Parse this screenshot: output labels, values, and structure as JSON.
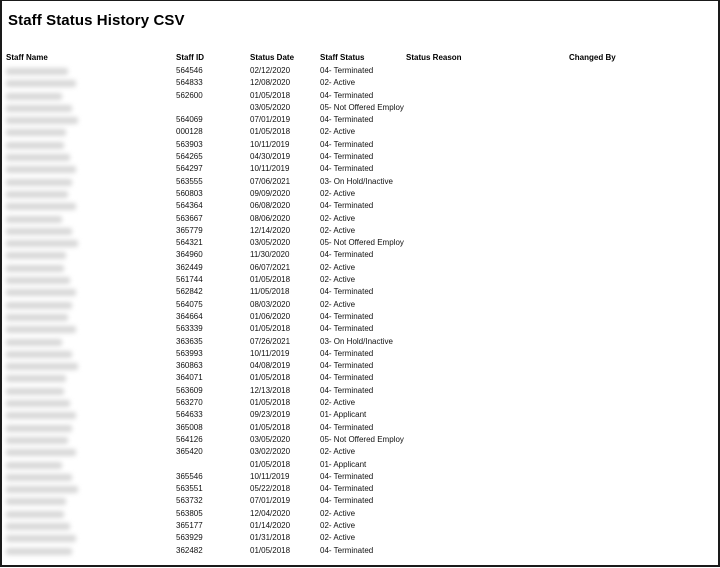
{
  "title": "Staff Status History CSV",
  "columns": [
    "Staff Name",
    "Staff ID",
    "Status Date",
    "Staff Status",
    "Status Reason",
    "Changed By"
  ],
  "rows": [
    {
      "name": "",
      "id": "564546",
      "date": "02/12/2020",
      "status": "04- Terminated",
      "reason": "",
      "changed_by": ""
    },
    {
      "name": "",
      "id": "564833",
      "date": "12/08/2020",
      "status": "02- Active",
      "reason": "",
      "changed_by": ""
    },
    {
      "name": "",
      "id": "562600",
      "date": "01/05/2018",
      "status": "04- Terminated",
      "reason": "",
      "changed_by": ""
    },
    {
      "name": "",
      "id": "",
      "date": "03/05/2020",
      "status": "05- Not Offered Employ",
      "reason": "",
      "changed_by": ""
    },
    {
      "name": "",
      "id": "564069",
      "date": "07/01/2019",
      "status": "04- Terminated",
      "reason": "",
      "changed_by": ""
    },
    {
      "name": "",
      "id": "000128",
      "date": "01/05/2018",
      "status": "02- Active",
      "reason": "",
      "changed_by": ""
    },
    {
      "name": "",
      "id": "563903",
      "date": "10/11/2019",
      "status": "04- Terminated",
      "reason": "",
      "changed_by": ""
    },
    {
      "name": "",
      "id": "564265",
      "date": "04/30/2019",
      "status": "04- Terminated",
      "reason": "",
      "changed_by": ""
    },
    {
      "name": "",
      "id": "564297",
      "date": "10/11/2019",
      "status": "04- Terminated",
      "reason": "",
      "changed_by": ""
    },
    {
      "name": "",
      "id": "563555",
      "date": "07/06/2021",
      "status": "03- On Hold/Inactive",
      "reason": "",
      "changed_by": ""
    },
    {
      "name": "",
      "id": "560803",
      "date": "09/09/2020",
      "status": "02- Active",
      "reason": "",
      "changed_by": ""
    },
    {
      "name": "",
      "id": "564364",
      "date": "06/08/2020",
      "status": "04- Terminated",
      "reason": "",
      "changed_by": ""
    },
    {
      "name": "",
      "id": "563667",
      "date": "08/06/2020",
      "status": "02- Active",
      "reason": "",
      "changed_by": ""
    },
    {
      "name": "",
      "id": "365779",
      "date": "12/14/2020",
      "status": "02- Active",
      "reason": "",
      "changed_by": ""
    },
    {
      "name": "",
      "id": "564321",
      "date": "03/05/2020",
      "status": "05- Not Offered Employ",
      "reason": "",
      "changed_by": ""
    },
    {
      "name": "",
      "id": "364960",
      "date": "11/30/2020",
      "status": "04- Terminated",
      "reason": "",
      "changed_by": ""
    },
    {
      "name": "",
      "id": "362449",
      "date": "06/07/2021",
      "status": "02- Active",
      "reason": "",
      "changed_by": ""
    },
    {
      "name": "",
      "id": "561744",
      "date": "01/05/2018",
      "status": "02- Active",
      "reason": "",
      "changed_by": ""
    },
    {
      "name": "",
      "id": "562842",
      "date": "11/05/2018",
      "status": "04- Terminated",
      "reason": "",
      "changed_by": ""
    },
    {
      "name": "",
      "id": "564075",
      "date": "08/03/2020",
      "status": "02- Active",
      "reason": "",
      "changed_by": ""
    },
    {
      "name": "",
      "id": "364664",
      "date": "01/06/2020",
      "status": "04- Terminated",
      "reason": "",
      "changed_by": ""
    },
    {
      "name": "",
      "id": "563339",
      "date": "01/05/2018",
      "status": "04- Terminated",
      "reason": "",
      "changed_by": ""
    },
    {
      "name": "",
      "id": "363635",
      "date": "07/26/2021",
      "status": "03- On Hold/Inactive",
      "reason": "",
      "changed_by": ""
    },
    {
      "name": "",
      "id": "563993",
      "date": "10/11/2019",
      "status": "04- Terminated",
      "reason": "",
      "changed_by": ""
    },
    {
      "name": "",
      "id": "360863",
      "date": "04/08/2019",
      "status": "04- Terminated",
      "reason": "",
      "changed_by": ""
    },
    {
      "name": "",
      "id": "364071",
      "date": "01/05/2018",
      "status": "04- Terminated",
      "reason": "",
      "changed_by": ""
    },
    {
      "name": "",
      "id": "563609",
      "date": "12/13/2018",
      "status": "04- Terminated",
      "reason": "",
      "changed_by": ""
    },
    {
      "name": "",
      "id": "563270",
      "date": "01/05/2018",
      "status": "02- Active",
      "reason": "",
      "changed_by": ""
    },
    {
      "name": "",
      "id": "564633",
      "date": "09/23/2019",
      "status": "01- Applicant",
      "reason": "",
      "changed_by": ""
    },
    {
      "name": "",
      "id": "365008",
      "date": "01/05/2018",
      "status": "04- Terminated",
      "reason": "",
      "changed_by": ""
    },
    {
      "name": "",
      "id": "564126",
      "date": "03/05/2020",
      "status": "05- Not Offered Employ",
      "reason": "",
      "changed_by": ""
    },
    {
      "name": "",
      "id": "365420",
      "date": "03/02/2020",
      "status": "02- Active",
      "reason": "",
      "changed_by": ""
    },
    {
      "name": "",
      "id": "",
      "date": "01/05/2018",
      "status": "01- Applicant",
      "reason": "",
      "changed_by": ""
    },
    {
      "name": "",
      "id": "365546",
      "date": "10/11/2019",
      "status": "04- Terminated",
      "reason": "",
      "changed_by": ""
    },
    {
      "name": "",
      "id": "563551",
      "date": "05/22/2018",
      "status": "04- Terminated",
      "reason": "",
      "changed_by": ""
    },
    {
      "name": "",
      "id": "563732",
      "date": "07/01/2019",
      "status": "04- Terminated",
      "reason": "",
      "changed_by": ""
    },
    {
      "name": "",
      "id": "563805",
      "date": "12/04/2020",
      "status": "02- Active",
      "reason": "",
      "changed_by": ""
    },
    {
      "name": "",
      "id": "365177",
      "date": "01/14/2020",
      "status": "02- Active",
      "reason": "",
      "changed_by": ""
    },
    {
      "name": "",
      "id": "563929",
      "date": "01/31/2018",
      "status": "02- Active",
      "reason": "",
      "changed_by": ""
    },
    {
      "name": "",
      "id": "362482",
      "date": "01/05/2018",
      "status": "04- Terminated",
      "reason": "",
      "changed_by": ""
    }
  ]
}
